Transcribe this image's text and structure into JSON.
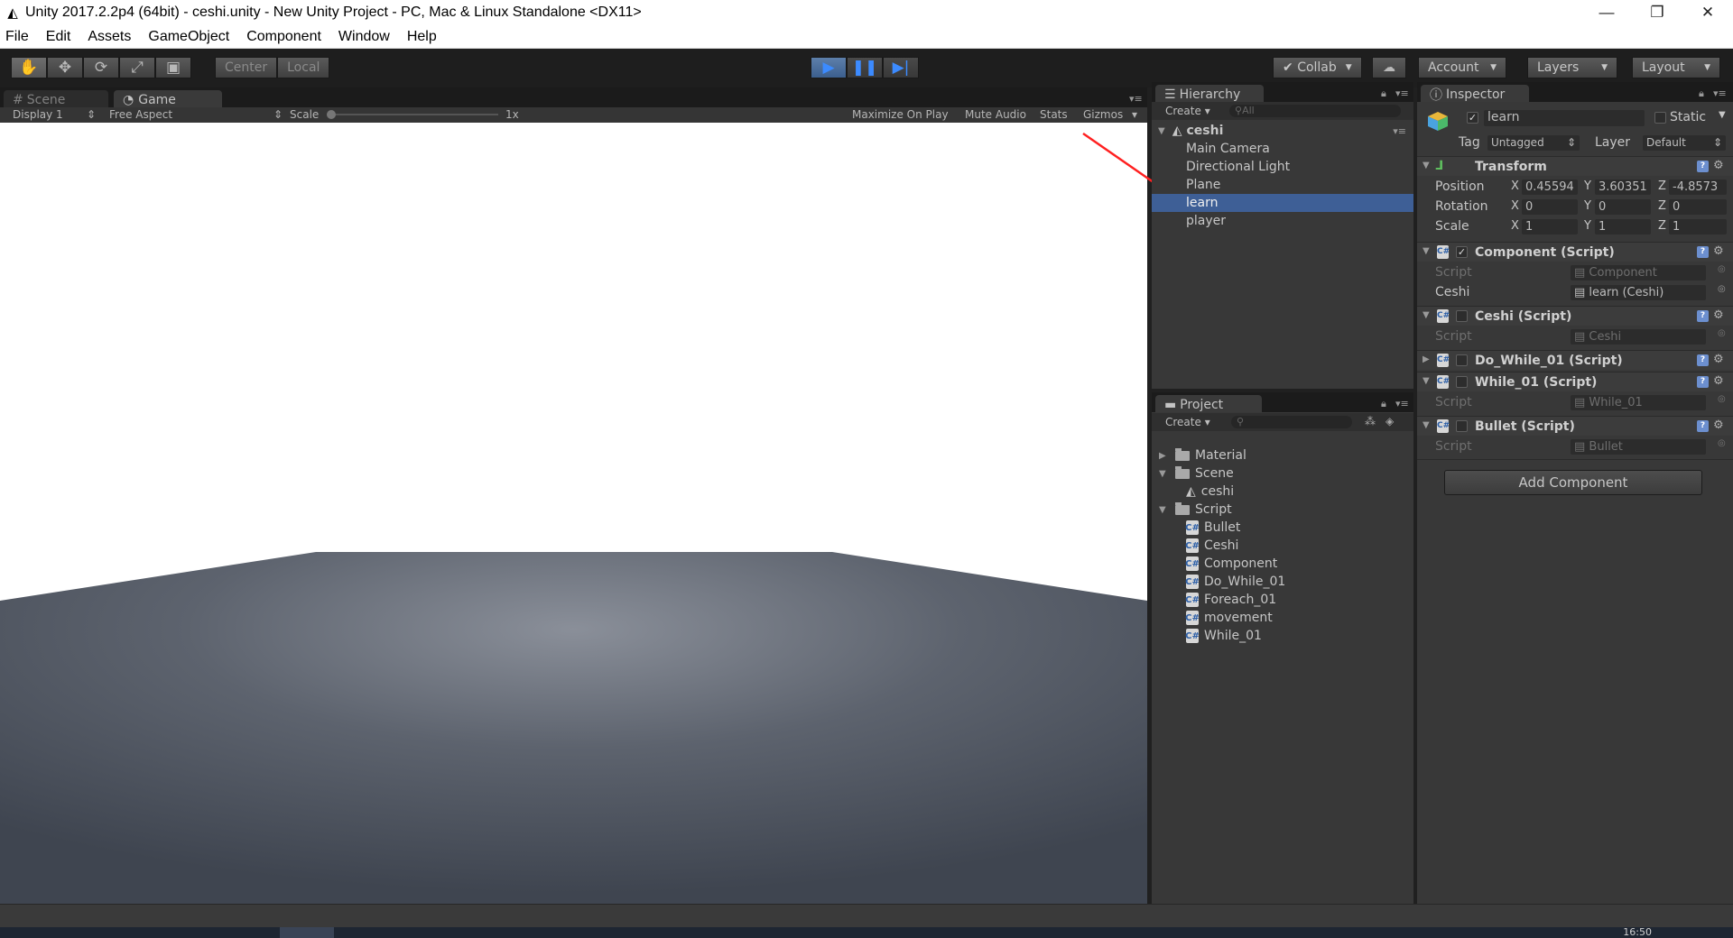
{
  "window": {
    "title": "Unity 2017.2.2p4 (64bit) - ceshi.unity - New Unity Project - PC, Mac & Linux Standalone <DX11>",
    "minimize": "—",
    "maximize": "❐",
    "close": "✕"
  },
  "menu": [
    "File",
    "Edit",
    "Assets",
    "GameObject",
    "Component",
    "Window",
    "Help"
  ],
  "toolbar": {
    "pivot_center": "Center",
    "pivot_local": "Local",
    "collab": "Collab",
    "account": "Account",
    "layers": "Layers",
    "layout": "Layout"
  },
  "scene_tab": "Scene",
  "game_tab": "Game",
  "game_bar": {
    "display": "Display 1",
    "aspect": "Free Aspect",
    "scale_label": "Scale",
    "scale_value": "1x",
    "maximize": "Maximize On Play",
    "mute": "Mute Audio",
    "stats": "Stats",
    "gizmos": "Gizmos"
  },
  "hierarchy": {
    "tab": "Hierarchy",
    "create": "Create",
    "search_placeholder": "All",
    "scene": "ceshi",
    "items": [
      "Main Camera",
      "Directional Light",
      "Plane",
      "learn",
      "player"
    ],
    "selected_index": 3
  },
  "project": {
    "tab": "Project",
    "create": "Create",
    "tree": [
      {
        "name": "Material",
        "type": "folder",
        "depth": 0,
        "expanded": false
      },
      {
        "name": "Scene",
        "type": "folder",
        "depth": 0,
        "expanded": true
      },
      {
        "name": "ceshi",
        "type": "scene",
        "depth": 1
      },
      {
        "name": "Script",
        "type": "folder",
        "depth": 0,
        "expanded": true
      },
      {
        "name": "Bullet",
        "type": "script",
        "depth": 1
      },
      {
        "name": "Ceshi",
        "type": "script",
        "depth": 1
      },
      {
        "name": "Component",
        "type": "script",
        "depth": 1
      },
      {
        "name": "Do_While_01",
        "type": "script",
        "depth": 1
      },
      {
        "name": "Foreach_01",
        "type": "script",
        "depth": 1
      },
      {
        "name": "movement",
        "type": "script",
        "depth": 1
      },
      {
        "name": "While_01",
        "type": "script",
        "depth": 1
      }
    ]
  },
  "inspector": {
    "tab": "Inspector",
    "object_name": "learn",
    "static_label": "Static",
    "tag_label": "Tag",
    "tag_value": "Untagged",
    "layer_label": "Layer",
    "layer_value": "Default",
    "transform": {
      "title": "Transform",
      "position_label": "Position",
      "rotation_label": "Rotation",
      "scale_label": "Scale",
      "position": [
        "0.45594",
        "3.60351",
        "-4.8573"
      ],
      "rotation": [
        "0",
        "0",
        "0"
      ],
      "scale": [
        "1",
        "1",
        "1"
      ],
      "x": "X",
      "y": "Y",
      "z": "Z"
    },
    "components": [
      {
        "title": "Component (Script)",
        "checked": true,
        "script_label": "Script",
        "script_value": "Component",
        "extra_label": "Ceshi",
        "extra_value": "learn (Ceshi)"
      },
      {
        "title": "Ceshi (Script)",
        "checked": false,
        "script_label": "Script",
        "script_value": "Ceshi"
      },
      {
        "title": "Do_While_01 (Script)",
        "checked": false,
        "collapsed": true
      },
      {
        "title": "While_01 (Script)",
        "checked": false,
        "script_label": "Script",
        "script_value": "While_01"
      },
      {
        "title": "Bullet (Script)",
        "checked": false,
        "script_label": "Script",
        "script_value": "Bullet"
      }
    ],
    "add_component": "Add Component"
  },
  "taskbar": {
    "clock": "16:50"
  },
  "colors": {
    "selection": "#3e5f96",
    "play_blue": "#3c8bff",
    "annotation_arrow": "#ff2020"
  }
}
